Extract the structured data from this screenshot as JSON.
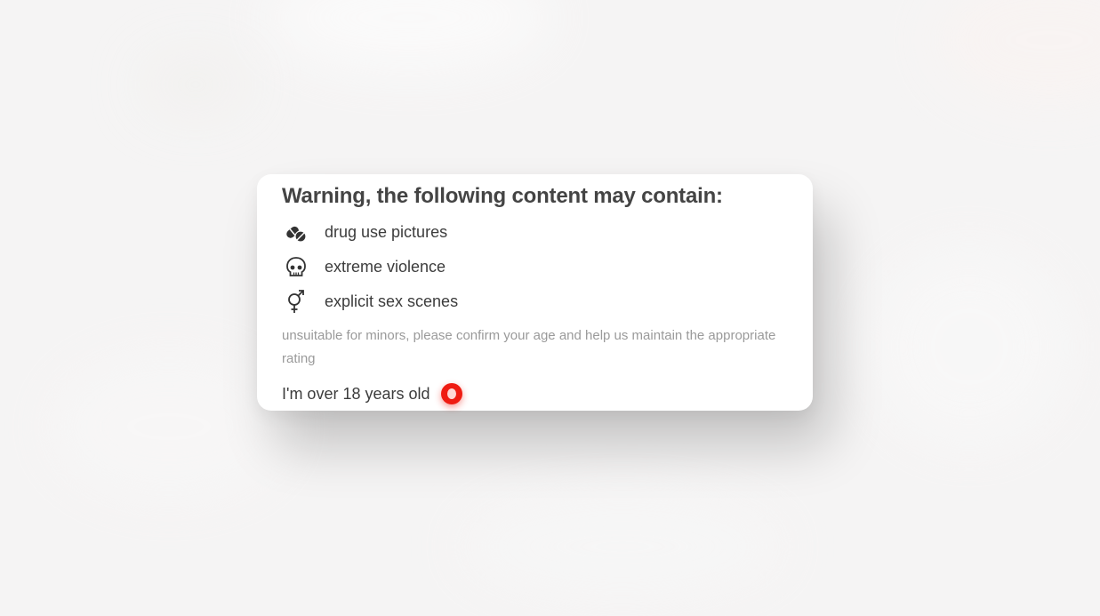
{
  "modal": {
    "title": "Warning, the following content may contain:",
    "items": [
      {
        "icon": "pills-icon",
        "label": "drug use pictures"
      },
      {
        "icon": "skull-icon",
        "label": "extreme violence"
      },
      {
        "icon": "gender-symbol-icon",
        "label": "explicit sex scenes"
      }
    ],
    "note": "unsuitable for minors, please confirm your age and help us maintain the appropriate rating",
    "confirm": {
      "label": "I'm over 18 years old",
      "checked": false
    }
  },
  "colors": {
    "accent": "#ef1c12",
    "title": "#444444",
    "text": "#3c3c3c",
    "muted": "#9a9a9a",
    "background": "#f5f4f4"
  }
}
